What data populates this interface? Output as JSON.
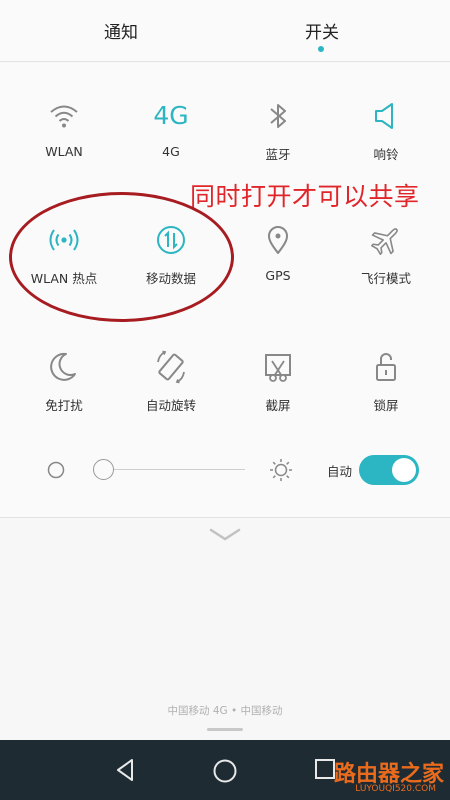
{
  "tabs": {
    "notify": "通知",
    "switch": "开关"
  },
  "tiles": {
    "wlan": "WLAN",
    "net4g": "4G",
    "net4g_glyph": "4G",
    "bluetooth": "蓝牙",
    "ringer": "响铃",
    "hotspot": "WLAN 热点",
    "mobile_data": "移动数据",
    "gps": "GPS",
    "airplane": "飞行模式",
    "dnd": "免打扰",
    "rotate": "自动旋转",
    "screenshot": "截屏",
    "lock": "锁屏"
  },
  "annotation": "同时打开才可以共享",
  "brightness": {
    "auto_label": "自动",
    "auto_on": true,
    "level": 0.0
  },
  "carrier": "中国移动 4G • 中国移动",
  "watermark": {
    "main": "路由器之家",
    "sub": "LUYOUQI520.COM"
  },
  "colors": {
    "accent": "#2cb5c2",
    "icon_gray": "#888888",
    "annotation": "#e0262b",
    "navbar": "#1f2b33"
  }
}
